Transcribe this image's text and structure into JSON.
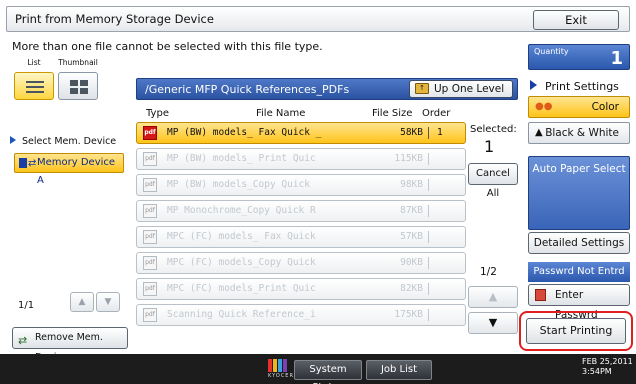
{
  "title": "Print from Memory Storage Device",
  "exit_label": "Exit",
  "message": "More than one file cannot be selected with this file type.",
  "view_tabs": {
    "list_label": "List",
    "thumbnail_label": "Thumbnail"
  },
  "left_panel": {
    "select_device_label": "Select Mem. Device",
    "device_name": "Memory Device A",
    "page_indicator": "1/1",
    "remove_label": "Remove Mem. Device"
  },
  "path_bar": {
    "path": "/Generic MFP Quick References_PDFs",
    "up_label": "Up One Level"
  },
  "columns": {
    "type": "Type",
    "file_name": "File Name",
    "file_size": "File Size",
    "order": "Order"
  },
  "files": [
    {
      "type": "pdf",
      "name": "MP (BW) models_ Fax Quick _",
      "size": "58KB",
      "order": "1"
    },
    {
      "type": "pdf",
      "name": "MP (BW) models_ Print Quic",
      "size": "115KB",
      "order": ""
    },
    {
      "type": "pdf",
      "name": "MP (BW) models_Copy Quick",
      "size": "98KB",
      "order": ""
    },
    {
      "type": "pdf",
      "name": "MP Monochrome_Copy Quick R",
      "size": "87KB",
      "order": ""
    },
    {
      "type": "pdf",
      "name": "MPC (FC) models_ Fax Quick",
      "size": "57KB",
      "order": ""
    },
    {
      "type": "pdf",
      "name": "MPC (FC) models_Copy Quick",
      "size": "90KB",
      "order": ""
    },
    {
      "type": "pdf",
      "name": "MPC (FC) models_Print Quic",
      "size": "82KB",
      "order": ""
    },
    {
      "type": "pdf",
      "name": "Scanning Quick Reference_i",
      "size": "175KB",
      "order": ""
    }
  ],
  "selection": {
    "label": "Selected:",
    "count": "1",
    "cancel_label": "Cancel All"
  },
  "pagination": {
    "page": "1/2",
    "up_icon": "up-arrow",
    "down_icon": "down-arrow"
  },
  "quantity": {
    "label": "Quantity",
    "value": "1"
  },
  "print_settings": {
    "label": "Print Settings",
    "color_label": "Color",
    "bw_label": "Black & White",
    "auto_paper_label": "Auto Paper Select",
    "detailed_label": "Detailed Settings"
  },
  "password": {
    "status": "Passwrd Not Entrd",
    "enter_label": "Enter Passwrd"
  },
  "start_label": "Start Printing",
  "bottom_bar": {
    "system_status": "System Status",
    "job_list": "Job List",
    "logo_text": "KYOCERA",
    "date": "FEB  25,2011",
    "time": "3:54PM"
  },
  "colors": {
    "accent_blue": "#2b57ad",
    "selected_yellow": "#ffc41a",
    "highlight_red": "#e02020"
  }
}
